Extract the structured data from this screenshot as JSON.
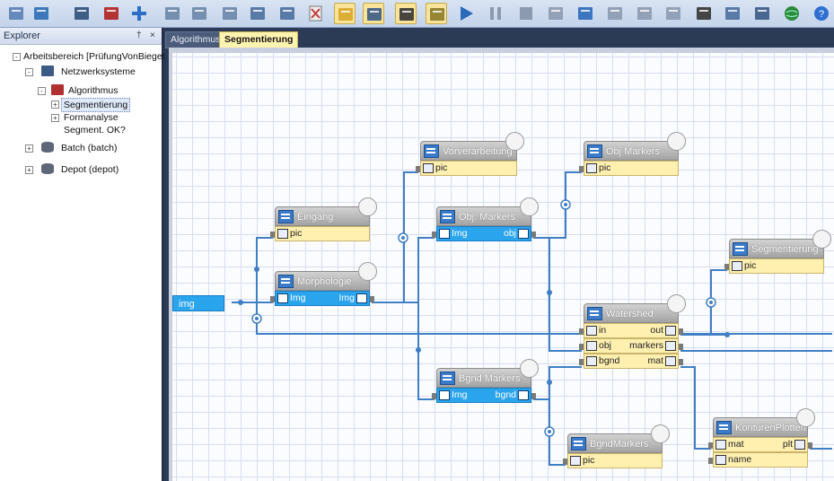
{
  "explorer": {
    "title": "Explorer",
    "pin": "†",
    "close": "×",
    "tree": {
      "root": "Arbeitsbereich [PrüfungVonBieget",
      "netzwerksysteme": "Netzwerksysteme",
      "algorithmus": "Algorithmus",
      "segmentierung": "Segmentierung",
      "formanalyse": "Formanalyse",
      "segment_ok": "Segment. OK?",
      "batch": "Batch (batch)",
      "depot": "Depot (depot)"
    }
  },
  "tabs": [
    {
      "label": "Algorithmus"
    },
    {
      "label": "Segmentierung"
    }
  ],
  "nodes": {
    "input_port": "img",
    "eingang": {
      "title": "Eingang",
      "port": "pic"
    },
    "morphologie": {
      "title": "Morphologie",
      "in": "Img",
      "out": "Img"
    },
    "vorverarbeitung": {
      "title": "Vorverarbeitung",
      "port": "pic"
    },
    "obj_markers_fn": {
      "title": "Obj. Markers",
      "in": "Img",
      "out": "obj"
    },
    "obj_markers_view": {
      "title": "Obj Markers",
      "port": "pic"
    },
    "segmentierung_view": {
      "title": "Segmentierung",
      "port": "pic"
    },
    "watershed": {
      "title": "Watershed",
      "in": [
        "in",
        "obj",
        "bgnd"
      ],
      "out": [
        "out",
        "markers",
        "mat"
      ]
    },
    "bgnd_markers_fn": {
      "title": "Bgnd Markers",
      "in": "Img",
      "out": "bgnd"
    },
    "bgnd_markers_view": {
      "title": "BgndMarkers",
      "port": "pic"
    },
    "konturen_plotten": {
      "title": "KonturenPlotten",
      "in": [
        "mat",
        "name"
      ],
      "out": "plt"
    }
  },
  "toolbar_icons": [
    "new-icon",
    "open-icon",
    "save-icon",
    "save-as-icon",
    "add-icon",
    "cut-icon",
    "copy-icon",
    "paste-icon",
    "import-icon",
    "export-icon",
    "delete-icon",
    "properties-icon",
    "tools-icon",
    "script-icon",
    "module-icon",
    "run-icon",
    "pause-icon",
    "stop-icon",
    "step-icon",
    "debug-icon",
    "step-into-icon",
    "step-over-icon",
    "step-out-icon",
    "print-icon",
    "preview-icon",
    "settings-icon",
    "globe-icon",
    "help-icon"
  ],
  "colors": {
    "accent_blue": "#2ba4ee",
    "port_yellow": "#fff0b0",
    "wire": "#3f7fc4"
  }
}
